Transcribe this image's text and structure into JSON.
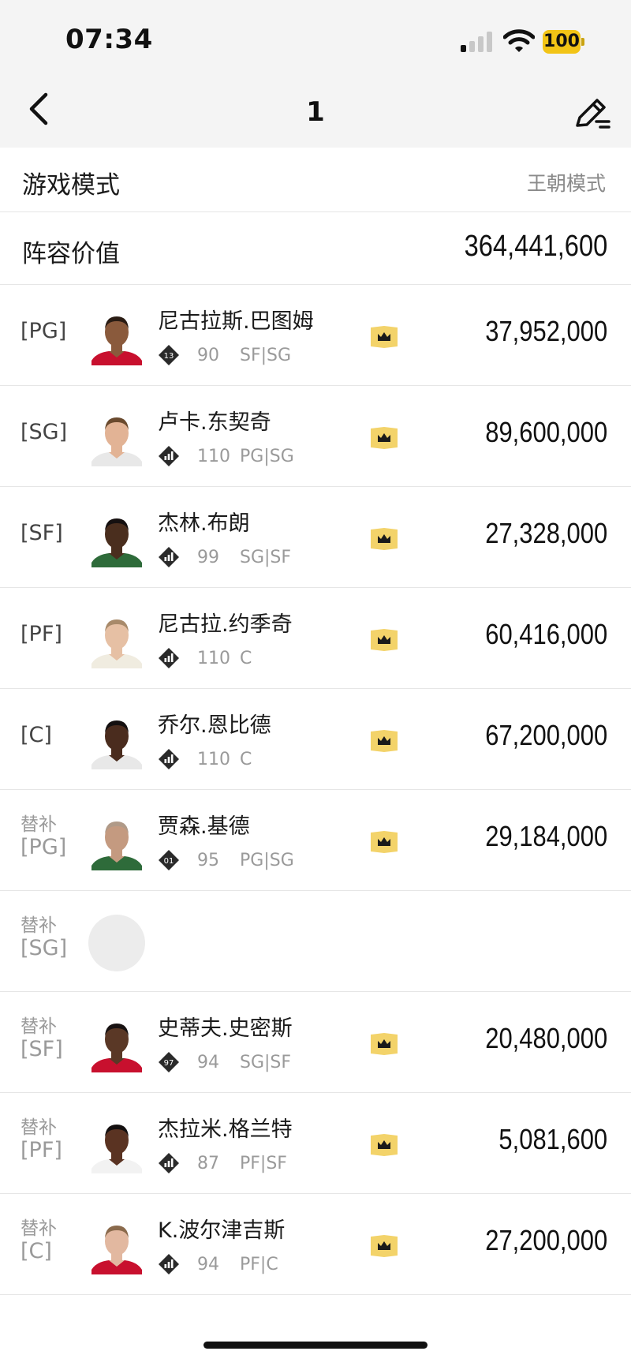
{
  "status_bar": {
    "time": "07:34",
    "battery": "100"
  },
  "nav": {
    "title": "1",
    "back_icon": "chevron-left-icon",
    "edit_icon": "edit-list-icon"
  },
  "game_mode": {
    "label": "游戏模式",
    "value": "王朝模式"
  },
  "lineup_value": {
    "label": "阵容价值",
    "value": "364,441,600"
  },
  "colors": {
    "crown_bg": "#f3d36a",
    "crown_fg": "#1a1a1a",
    "badge_bg": "#2a2a2a",
    "battery": "#f2c416"
  },
  "players": [
    {
      "sub_label": "",
      "position": "[PG]",
      "name": "尼古拉斯.巴图姆",
      "badge": "13",
      "rating": "90",
      "positions": "SF|SG",
      "salary": "37,952,000",
      "skin": "#8a5a3c",
      "hair": "#2a1c14",
      "jersey": "#c8102e",
      "empty": false
    },
    {
      "sub_label": "",
      "position": "[SG]",
      "name": "卢卡.东契奇",
      "badge": "bars",
      "rating": "110",
      "positions": "PG|SG",
      "salary": "89,600,000",
      "skin": "#e2b395",
      "hair": "#6a4a2e",
      "jersey": "#e8e8e8",
      "empty": false
    },
    {
      "sub_label": "",
      "position": "[SF]",
      "name": "杰林.布朗",
      "badge": "bars",
      "rating": "99",
      "positions": "SG|SF",
      "salary": "27,328,000",
      "skin": "#4a2e1e",
      "hair": "#151010",
      "jersey": "#2e6b3a",
      "empty": false
    },
    {
      "sub_label": "",
      "position": "[PF]",
      "name": "尼古拉.约季奇",
      "badge": "bars",
      "rating": "110",
      "positions": "C",
      "salary": "60,416,000",
      "skin": "#e6c0a4",
      "hair": "#a88a6a",
      "jersey": "#f0ece0",
      "empty": false
    },
    {
      "sub_label": "",
      "position": "[C]",
      "name": "乔尔.恩比德",
      "badge": "bars",
      "rating": "110",
      "positions": "C",
      "salary": "67,200,000",
      "skin": "#4a2c1e",
      "hair": "#141010",
      "jersey": "#e8e8e8",
      "empty": false
    },
    {
      "sub_label": "替补",
      "position": "[PG]",
      "name": "贾森.基德",
      "badge": "01",
      "rating": "95",
      "positions": "PG|SG",
      "salary": "29,184,000",
      "skin": "#c49a80",
      "hair": "#b09a88",
      "jersey": "#2e6b3a",
      "empty": false
    },
    {
      "sub_label": "替补",
      "position": "[SG]",
      "name": "",
      "badge": "",
      "rating": "",
      "positions": "",
      "salary": "",
      "skin": "",
      "hair": "",
      "jersey": "",
      "empty": true
    },
    {
      "sub_label": "替补",
      "position": "[SF]",
      "name": "史蒂夫.史密斯",
      "badge": "97",
      "rating": "94",
      "positions": "SG|SF",
      "salary": "20,480,000",
      "skin": "#5a3826",
      "hair": "#181212",
      "jersey": "#c8102e",
      "empty": false
    },
    {
      "sub_label": "替补",
      "position": "[PF]",
      "name": "杰拉米.格兰特",
      "badge": "bars",
      "rating": "87",
      "positions": "PF|SF",
      "salary": "5,081,600",
      "skin": "#5a3322",
      "hair": "#141010",
      "jersey": "#f2f2f2",
      "empty": false
    },
    {
      "sub_label": "替补",
      "position": "[C]",
      "name": "K.波尔津吉斯",
      "badge": "bars",
      "rating": "94",
      "positions": "PF|C",
      "salary": "27,200,000",
      "skin": "#e2b8a0",
      "hair": "#8a6a4c",
      "jersey": "#c8102e",
      "empty": false
    }
  ]
}
